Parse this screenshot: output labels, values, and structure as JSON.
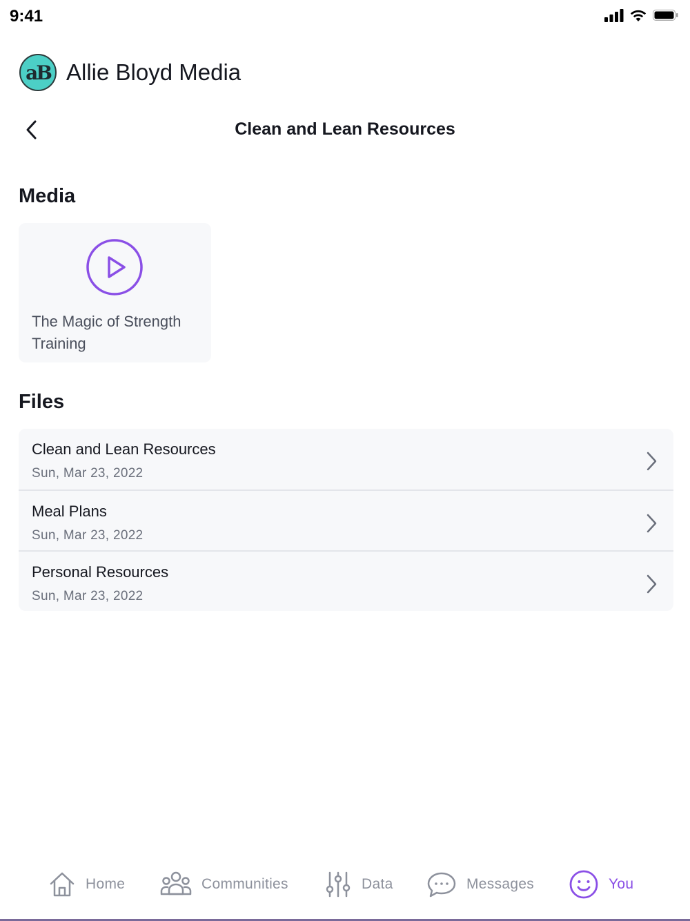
{
  "status": {
    "time": "9:41"
  },
  "brand": {
    "logo_text": "aB",
    "name": "Allie Bloyd Media",
    "logo_color": "#4ccfc6"
  },
  "header": {
    "title": "Clean and Lean Resources"
  },
  "media": {
    "section_title": "Media",
    "items": [
      {
        "title": "The Magic of Strength Training",
        "icon": "play-circle-icon"
      }
    ]
  },
  "files": {
    "section_title": "Files",
    "items": [
      {
        "name": "Clean and Lean Resources",
        "date": "Sun, Mar 23, 2022"
      },
      {
        "name": "Meal Plans",
        "date": "Sun, Mar 23, 2022"
      },
      {
        "name": "Personal Resources",
        "date": "Sun, Mar 23, 2022"
      }
    ]
  },
  "tabs": [
    {
      "label": "Home",
      "icon": "home-icon",
      "active": false
    },
    {
      "label": "Communities",
      "icon": "people-icon",
      "active": false
    },
    {
      "label": "Data",
      "icon": "sliders-icon",
      "active": false
    },
    {
      "label": "Messages",
      "icon": "chat-bubble-icon",
      "active": false
    },
    {
      "label": "You",
      "icon": "smile-icon",
      "active": true
    }
  ],
  "colors": {
    "accent": "#8a4fe6",
    "inactive_tab": "#8d919c",
    "card_bg": "#f7f8fa"
  }
}
